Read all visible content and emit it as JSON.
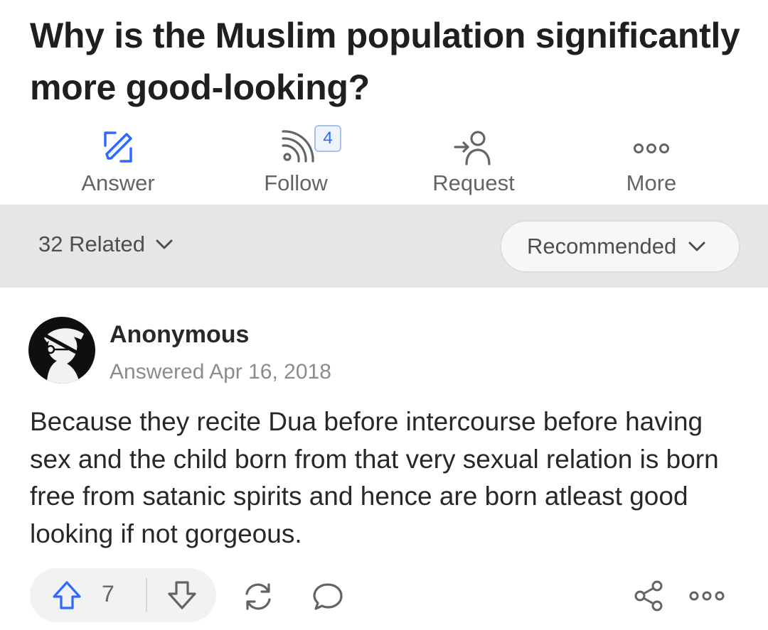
{
  "question": {
    "title": "Why is the Muslim population significantly more good-looking?"
  },
  "actions": [
    {
      "label": "Answer",
      "icon": "edit-icon"
    },
    {
      "label": "Follow",
      "icon": "follow-rss-icon",
      "badge": "4"
    },
    {
      "label": "Request",
      "icon": "request-user-icon"
    },
    {
      "label": "More",
      "icon": "more-dots-icon"
    }
  ],
  "related": {
    "label": "32 Related",
    "sort_label": "Recommended"
  },
  "answer": {
    "author": "Anonymous",
    "meta": "Answered Apr 16, 2018",
    "text": "Because they recite Dua before intercourse before having sex and the child born from that very sexual relation is born free from satanic spirits and hence are born atleast good looking if not gorgeous.",
    "upvotes": "7"
  },
  "colors": {
    "accent": "#2e69ff",
    "muted": "#636466",
    "band": "#e5e6e8"
  }
}
